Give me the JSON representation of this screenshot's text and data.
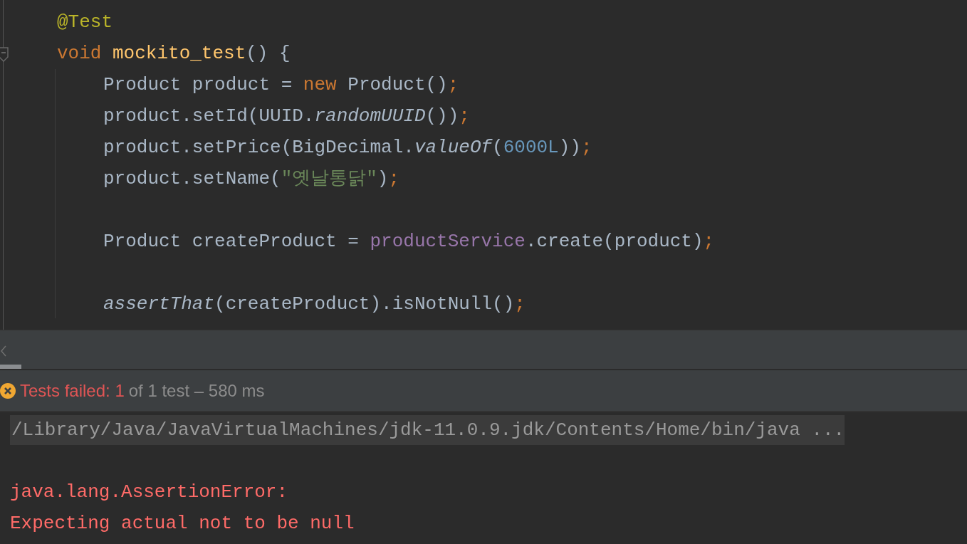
{
  "editor": {
    "lines": [
      {
        "kind": "head",
        "tokens": [
          {
            "kind": "annotation",
            "text": "@Test"
          }
        ]
      },
      {
        "kind": "head",
        "tokens": [
          {
            "kind": "keyword",
            "text": "void "
          },
          {
            "kind": "decl",
            "text": "mockito_test"
          },
          {
            "kind": "plain",
            "text": "() {"
          }
        ]
      },
      {
        "kind": "body",
        "tokens": [
          {
            "kind": "plain",
            "text": "Product product = "
          },
          {
            "kind": "keyword",
            "text": "new "
          },
          {
            "kind": "plain",
            "text": "Product()"
          },
          {
            "kind": "punct",
            "text": ";"
          }
        ]
      },
      {
        "kind": "body",
        "tokens": [
          {
            "kind": "plain",
            "text": "product.setId(UUID."
          },
          {
            "kind": "static",
            "text": "randomUUID"
          },
          {
            "kind": "plain",
            "text": "())"
          },
          {
            "kind": "punct",
            "text": ";"
          }
        ]
      },
      {
        "kind": "body",
        "tokens": [
          {
            "kind": "plain",
            "text": "product.setPrice(BigDecimal."
          },
          {
            "kind": "static",
            "text": "valueOf"
          },
          {
            "kind": "plain",
            "text": "("
          },
          {
            "kind": "number",
            "text": "6000L"
          },
          {
            "kind": "plain",
            "text": "))"
          },
          {
            "kind": "punct",
            "text": ";"
          }
        ]
      },
      {
        "kind": "body",
        "tokens": [
          {
            "kind": "plain",
            "text": "product.setName("
          },
          {
            "kind": "string",
            "text": "\"옛날통닭\""
          },
          {
            "kind": "plain",
            "text": ")"
          },
          {
            "kind": "punct",
            "text": ";"
          }
        ]
      },
      {
        "kind": "blank"
      },
      {
        "kind": "body",
        "tokens": [
          {
            "kind": "plain",
            "text": "Product createProduct = "
          },
          {
            "kind": "field",
            "text": "productService"
          },
          {
            "kind": "plain",
            "text": ".create(product)"
          },
          {
            "kind": "punct",
            "text": ";"
          }
        ]
      },
      {
        "kind": "blank"
      },
      {
        "kind": "body",
        "tokens": [
          {
            "kind": "static",
            "text": "assertThat"
          },
          {
            "kind": "plain",
            "text": "(createProduct).isNotNull()"
          },
          {
            "kind": "punct",
            "text": ";"
          }
        ]
      }
    ]
  },
  "run_status": {
    "failed": "Tests failed: 1",
    "detail": "of 1 test – 580 ms"
  },
  "console": {
    "command": "/Library/Java/JavaVirtualMachines/jdk-11.0.9.jdk/Contents/Home/bin/java ...",
    "errors": [
      "java.lang.AssertionError:",
      "Expecting actual not to be null"
    ]
  }
}
